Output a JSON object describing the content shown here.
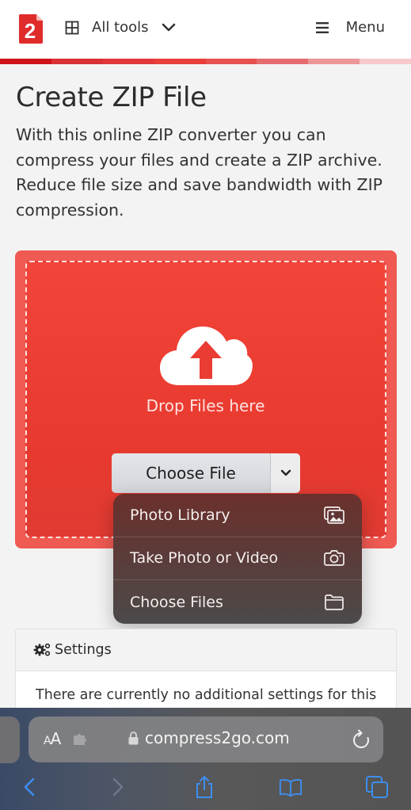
{
  "header": {
    "logo_text": "2",
    "all_tools_label": "All tools",
    "menu_label": "Menu",
    "stripe_colors": [
      "#d0121b",
      "#d93036",
      "#e2383b",
      "#ea3e3b",
      "#e7514f",
      "#e66d6f",
      "#eb9698",
      "#f8c9cc"
    ]
  },
  "main": {
    "title": "Create ZIP File",
    "intro": "With this online ZIP converter you can compress your files and create a ZIP archive. Reduce file size and save bandwidth with ZIP compression."
  },
  "dropzone": {
    "drop_text": "Drop Files here",
    "choose_file_label": "Choose File",
    "accent_color": "#ef4136"
  },
  "context_menu": {
    "items": [
      {
        "label": "Photo Library",
        "icon": "photo-library-icon"
      },
      {
        "label": "Take Photo or Video",
        "icon": "camera-icon"
      },
      {
        "label": "Choose Files",
        "icon": "folder-icon"
      }
    ]
  },
  "settings": {
    "heading": "Settings",
    "body": "There are currently no additional settings for this"
  },
  "browser": {
    "aa_label": "AA",
    "url": "compress2go.com",
    "accent_color": "#3d8ef0"
  }
}
